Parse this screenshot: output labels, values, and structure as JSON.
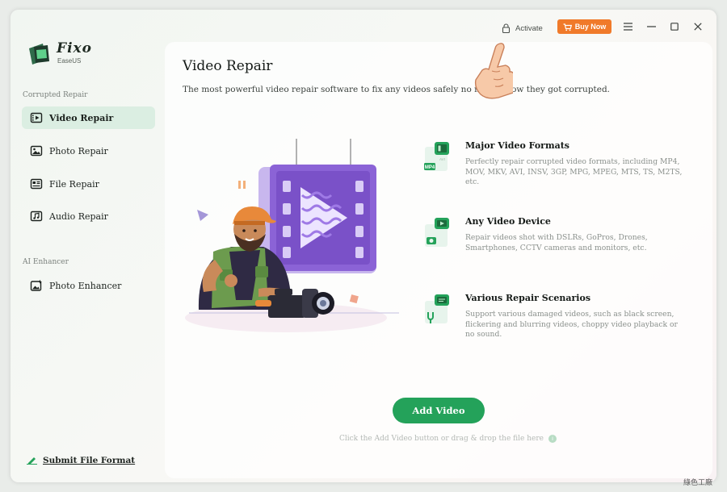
{
  "app": {
    "logo_name": "Fixo",
    "logo_sub": "EaseUS"
  },
  "titlebar": {
    "activate_label": "Activate",
    "buy_label": "Buy Now",
    "icons": [
      "lock-icon",
      "cart-icon",
      "menu-icon",
      "minimize-icon",
      "maximize-icon",
      "close-icon"
    ]
  },
  "sidebar": {
    "section_corrupted": "Corrupted Repair",
    "items": [
      {
        "label": "Video Repair",
        "icon": "film-icon",
        "active": true
      },
      {
        "label": "Photo Repair",
        "icon": "image-icon",
        "active": false
      },
      {
        "label": "File Repair",
        "icon": "document-icon",
        "active": false
      },
      {
        "label": "Audio Repair",
        "icon": "music-icon",
        "active": false
      }
    ],
    "section_ai": "AI Enhancer",
    "ai_items": [
      {
        "label": "Photo Enhancer",
        "icon": "sparkle-image-icon",
        "active": false
      }
    ],
    "submit_label": "Submit File Format"
  },
  "main": {
    "title": "Video Repair",
    "subtitle": "The most powerful video repair software to fix any videos safely no matter how they got corrupted.",
    "features": [
      {
        "title": "Major Video Formats",
        "desc": "Perfectly repair corrupted video formats, including MP4, MOV, MKV, AVI, INSV, 3GP, MPG, MPEG, MTS, TS, M2TS, etc.",
        "icon_badge": "MP4"
      },
      {
        "title": "Any Video Device",
        "desc": "Repair videos shot with DSLRs, GoPros, Drones, Smartphones, CCTV cameras and monitors, etc."
      },
      {
        "title": "Various Repair Scenarios",
        "desc": "Support various damaged videos, such as black screen, flickering and blurring videos, choppy video playback or no sound."
      }
    ],
    "add_video_label": "Add Video",
    "drop_hint": "Click the Add Video button or drag & drop the file here"
  },
  "colors": {
    "accent_green": "#24a25a",
    "active_nav_bg": "#dbeee2",
    "buy_orange": "#f07a2a",
    "illustration_purple": "#8b63d6"
  },
  "watermark": "綠色工廠"
}
